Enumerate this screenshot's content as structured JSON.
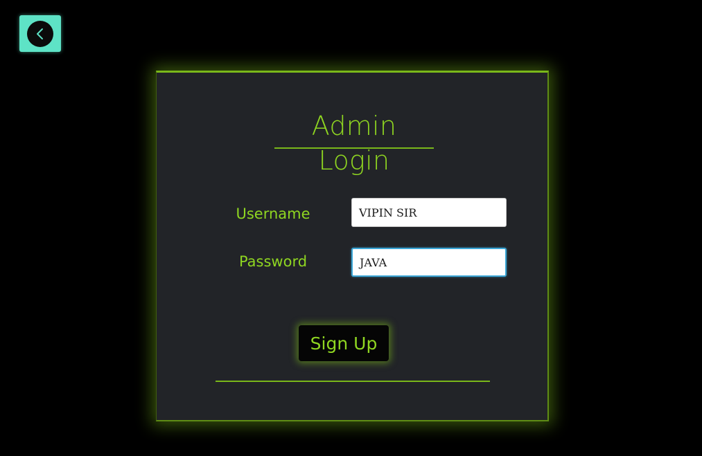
{
  "back_button": {
    "icon": "chevron-left-icon",
    "accent": "#5ee3c6"
  },
  "form": {
    "title": "Admin Login",
    "username_label": "Username",
    "username_value": "VIPIN SIR",
    "password_label": "Password",
    "password_value": "JAVA",
    "submit_label": "Sign Up"
  },
  "colors": {
    "accent": "#8fd621",
    "card_background": "#222428",
    "page_background": "#000000",
    "focus_border": "#3ba6d6"
  }
}
